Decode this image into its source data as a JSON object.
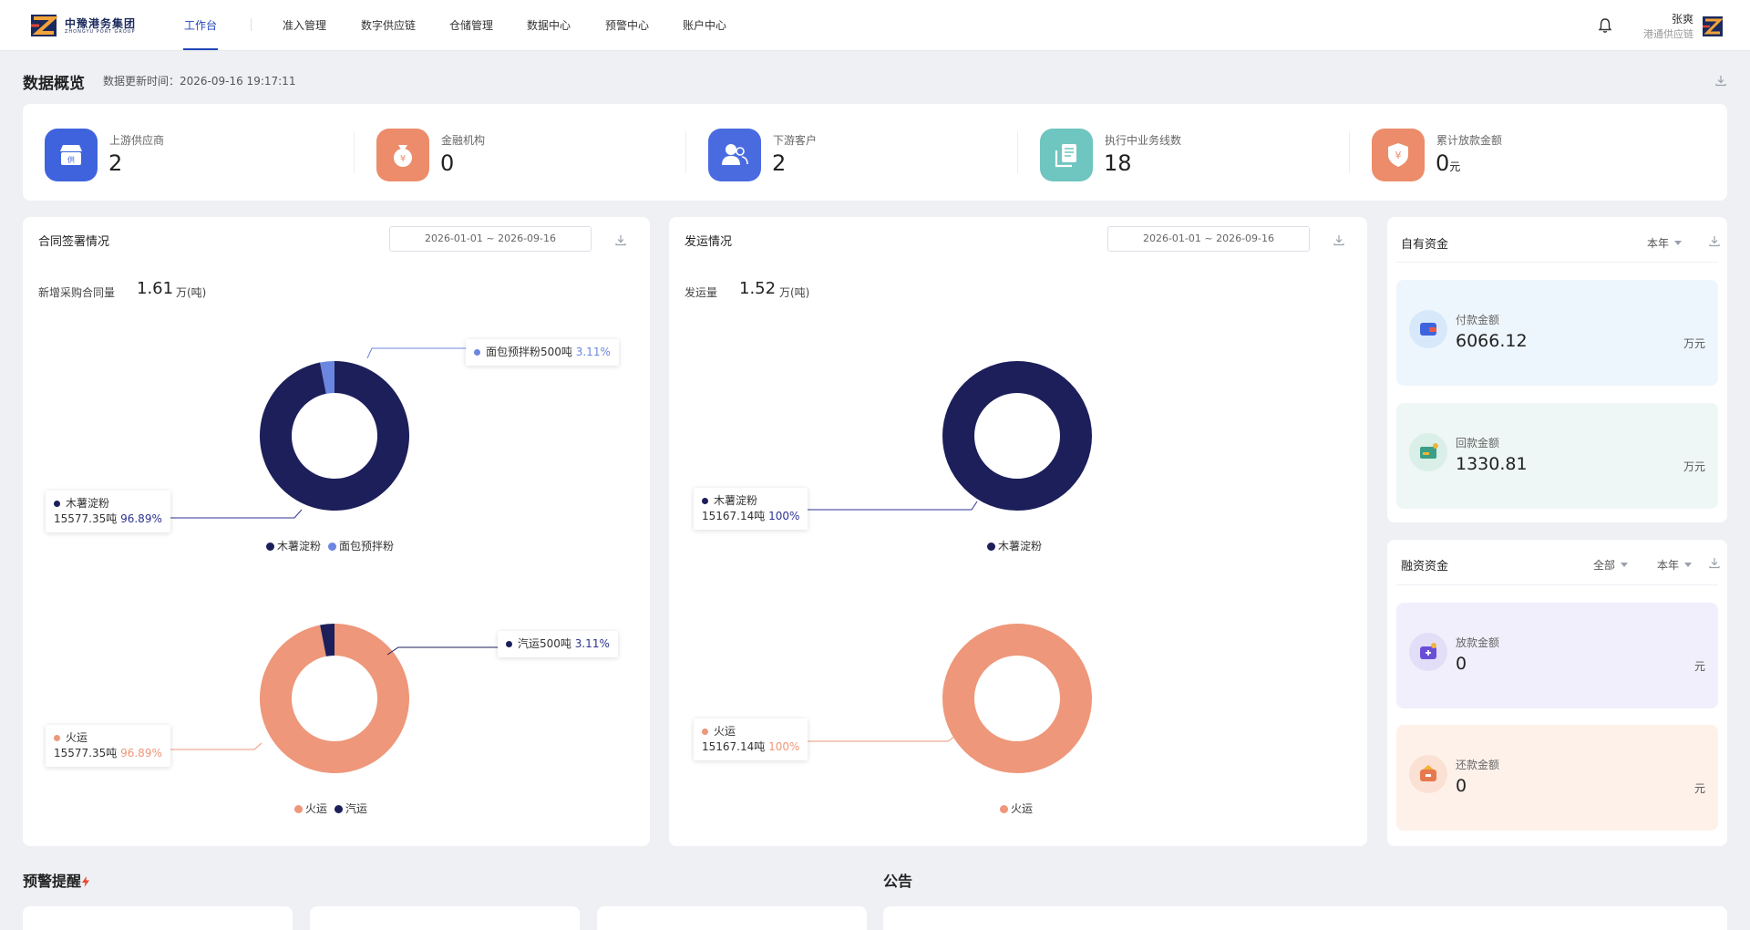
{
  "header": {
    "logo_name": "中豫港务集团",
    "logo_sub": "ZHONGYU PORT GROUP",
    "nav": [
      {
        "label": "工作台",
        "active": true
      },
      {
        "label": "准入管理"
      },
      {
        "label": "数字供应链"
      },
      {
        "label": "仓储管理"
      },
      {
        "label": "数据中心"
      },
      {
        "label": "预警中心"
      },
      {
        "label": "账户中心"
      }
    ],
    "user_name": "张爽",
    "user_org": "港通供应链"
  },
  "overview": {
    "title": "数据概览",
    "update_time": "数据更新时间：2026-09-16 19:17:11",
    "stats": [
      {
        "label": "上游供应商",
        "value": "2",
        "unit": "",
        "color": "#3e63dd",
        "icon": "store-icon"
      },
      {
        "label": "金融机构",
        "value": "0",
        "unit": "",
        "color": "#ec8c6a",
        "icon": "money-bag-icon"
      },
      {
        "label": "下游客户",
        "value": "2",
        "unit": "",
        "color": "#4a6be0",
        "icon": "users-icon"
      },
      {
        "label": "执行中业务线数",
        "value": "18",
        "unit": "",
        "color": "#6fc5bf",
        "icon": "document-stack-icon"
      },
      {
        "label": "累计放款金额",
        "value": "0",
        "unit": "元",
        "color": "#ec8c6a",
        "icon": "shield-yen-icon"
      }
    ]
  },
  "contract": {
    "title": "合同签署情况",
    "date_range": "2026-01-01   ~   2026-09-16",
    "metric_label": "新增采购合同量",
    "metric_value": "1.61",
    "metric_unit": "万(吨)"
  },
  "shipment": {
    "title": "发运情况",
    "date_range": "2026-01-01   ~   2026-09-16",
    "metric_label": "发运量",
    "metric_value": "1.52",
    "metric_unit": "万(吨)"
  },
  "chart_data": [
    {
      "type": "pie",
      "series": [
        {
          "name": "木薯淀粉",
          "value": 15577.35,
          "pct": "96.89%",
          "color": "#1c1f5a",
          "label": "15577.35吨"
        },
        {
          "name": "面包预拌粉",
          "value": 500,
          "pct": "3.11%",
          "color": "#6b86e0",
          "label": "面包预拌粉500吨"
        }
      ],
      "legend": [
        "木薯淀粉",
        "面包预拌粉"
      ]
    },
    {
      "type": "pie",
      "series": [
        {
          "name": "火运",
          "value": 15577.35,
          "pct": "96.89%",
          "color": "#ee977a",
          "label": "15577.35吨"
        },
        {
          "name": "汽运",
          "value": 500,
          "pct": "3.11%",
          "color": "#1c1f5a",
          "label": "汽运500吨"
        }
      ],
      "legend": [
        "火运",
        "汽运"
      ]
    },
    {
      "type": "pie",
      "series": [
        {
          "name": "木薯淀粉",
          "value": 15167.14,
          "pct": "100%",
          "color": "#1c1f5a",
          "label": "15167.14吨"
        }
      ],
      "legend": [
        "木薯淀粉"
      ]
    },
    {
      "type": "pie",
      "series": [
        {
          "name": "火运",
          "value": 15167.14,
          "pct": "100%",
          "color": "#ee977a",
          "label": "15167.14吨"
        }
      ],
      "legend": [
        "火运"
      ]
    }
  ],
  "own_funds": {
    "title": "自有资金",
    "period": "本年",
    "items": [
      {
        "label": "付款金额",
        "value": "6066.12",
        "unit": "万元"
      },
      {
        "label": "回款金额",
        "value": "1330.81",
        "unit": "万元"
      }
    ]
  },
  "financing": {
    "title": "融资资金",
    "scope": "全部",
    "period": "本年",
    "items": [
      {
        "label": "放款金额",
        "value": "0",
        "unit": "元"
      },
      {
        "label": "还款金额",
        "value": "0",
        "unit": "元"
      }
    ]
  },
  "warnings": {
    "title": "预警提醒"
  },
  "notices": {
    "title": "公告"
  }
}
